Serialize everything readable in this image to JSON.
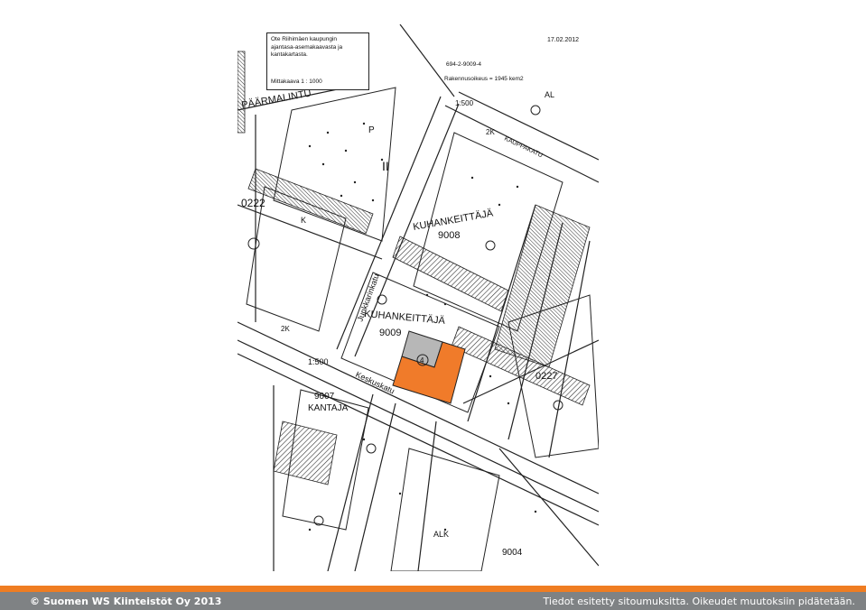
{
  "map": {
    "info_line1": "Ote Riihimäen kaupungin",
    "info_line2": "ajantasa-asemakaavasta ja",
    "info_line3": "kantakartasta.",
    "scale_label": "Mittakaava  1 : 1000",
    "date": "17.02.2012",
    "property_id": "694-2-9009-4",
    "building_rights": "Rakennusoikeus = 1945 kem2",
    "labels": {
      "kuhankeitta_upper": "KUHANKEITTÄJÄ",
      "block_9008": "9008",
      "kuhankeitta_lower": "KUHANKEITTÄJÄ",
      "block_9009": "9009",
      "kantaja": "KANTAJA",
      "block_9007": "9007",
      "block_9004": "9004",
      "alk": "ALK",
      "street_junkkari": "Junkkarinkatu",
      "street_keskus": "Keskuskatu",
      "street_kauppakatu": "KAUPPAKATU",
      "paarmalintu": "PÄÄRMALINTU",
      "area_0222": "0222",
      "area_0227": "0227",
      "scale_500a": "1:500",
      "scale_500b": "1:500",
      "plot_4": "4",
      "zone_2k_a": "2K",
      "zone_2k_b": "2K",
      "roman_ii": "II",
      "al": "AL",
      "p": "P",
      "k": "K"
    }
  },
  "colors": {
    "orange_plot": "#f07b2a",
    "gray_plot": "#b7b7b7",
    "footer_accent": "#ef7d22",
    "footer_bar": "#7f8284"
  },
  "footer": {
    "copyright": "© Suomen WS Kiinteistöt Oy 2013",
    "disclaimer": "Tiedot esitetty sitoumuksitta. Oikeudet muutoksiin pidätetään."
  }
}
